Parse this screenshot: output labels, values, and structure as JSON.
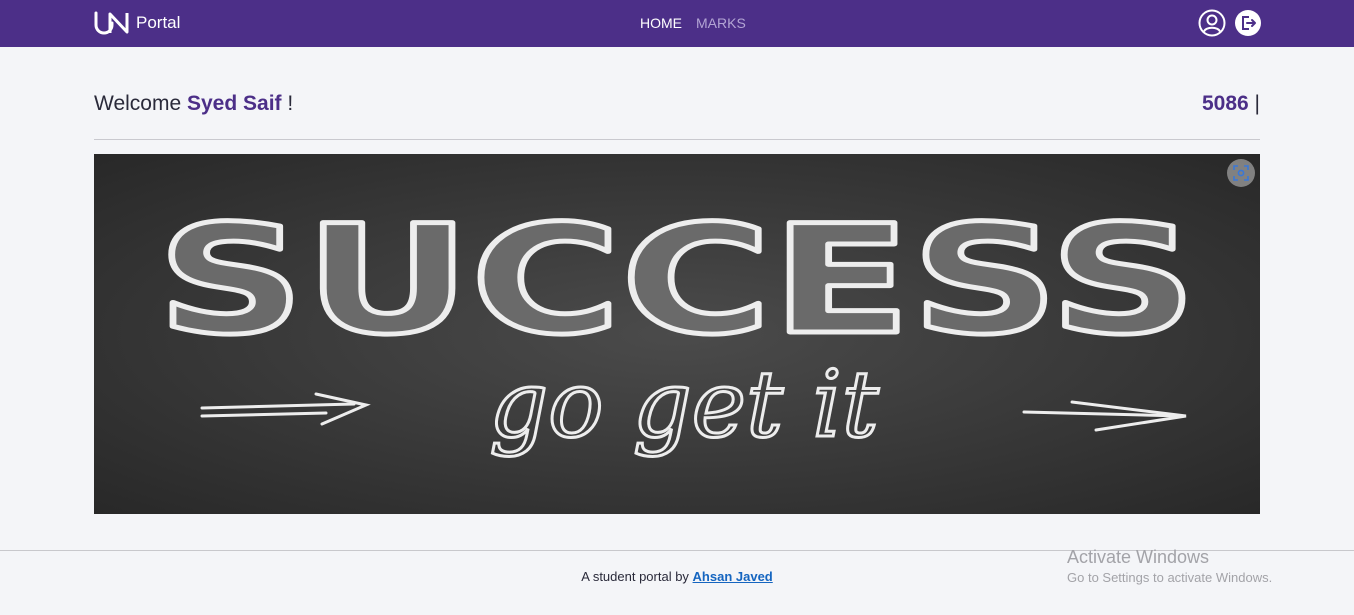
{
  "colors": {
    "navbar": "#4c2f88",
    "accent": "#4c2f88",
    "link": "#1565c0",
    "page_bg": "#f4f5f8"
  },
  "navbar": {
    "brand_text": "Portal",
    "links": [
      {
        "label": "HOME",
        "active": true
      },
      {
        "label": "MARKS",
        "active": false
      }
    ],
    "icons": [
      "user-circle-icon",
      "logout-icon"
    ]
  },
  "welcome": {
    "prefix": "Welcome ",
    "name": "Syed Saif",
    "suffix": " !"
  },
  "code": {
    "number": "5086",
    "separator": " |"
  },
  "hero": {
    "headline": "SUCCESS",
    "subline": "go get it",
    "lens_icon": "image-search-icon"
  },
  "footer": {
    "text": "A student portal by ",
    "author": "Ahsan Javed"
  },
  "watermark": {
    "title": "Activate Windows",
    "subtitle": "Go to Settings to activate Windows."
  }
}
